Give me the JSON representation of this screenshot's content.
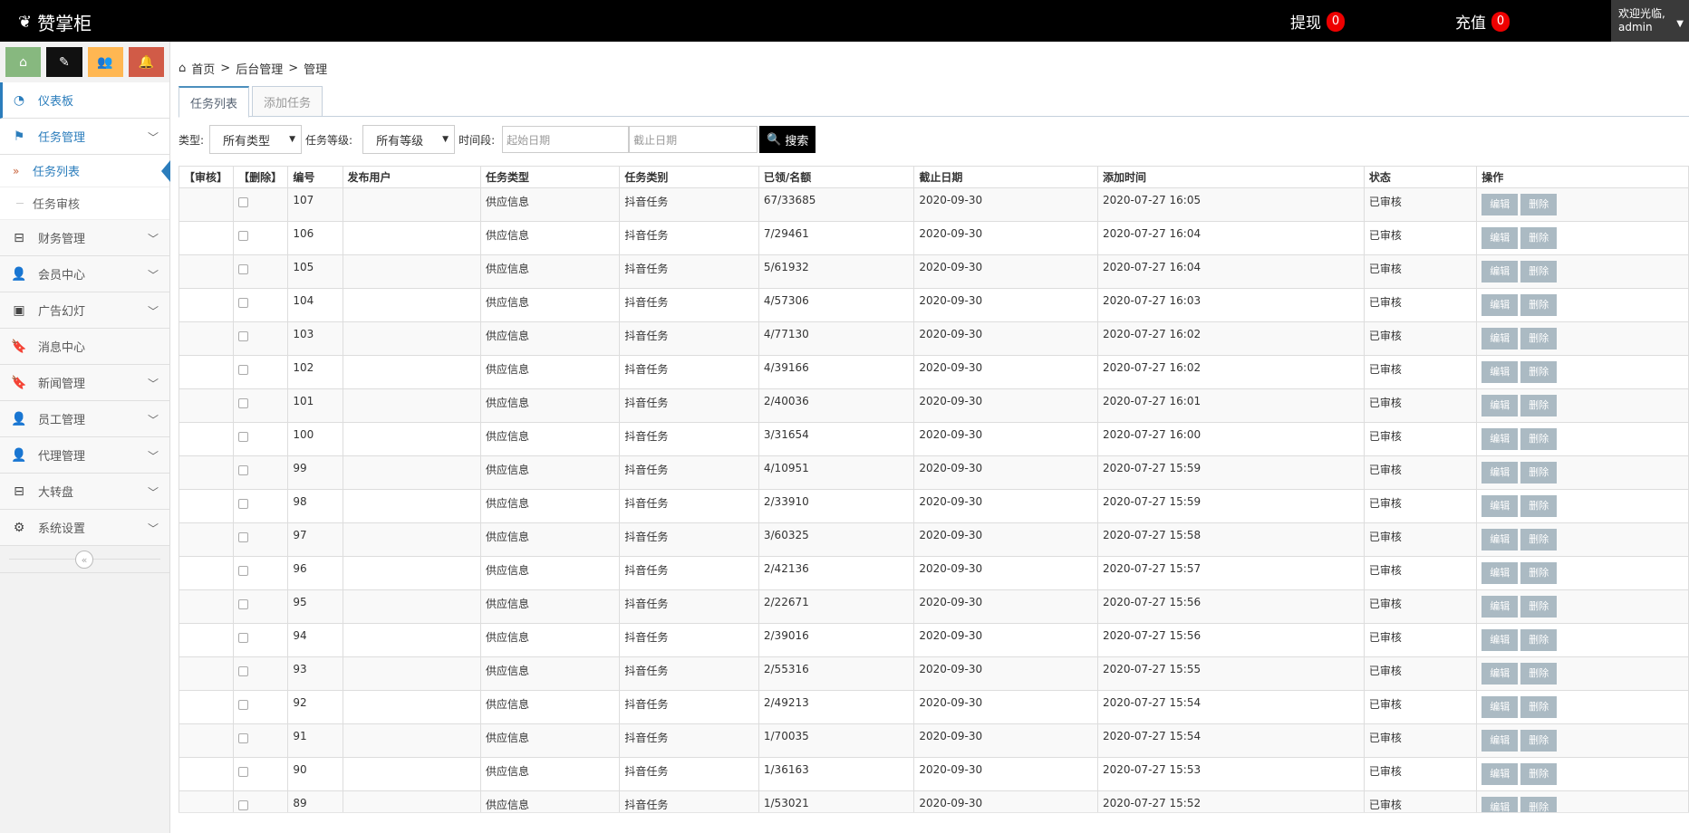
{
  "app": {
    "brand": "赞掌柜",
    "withdraw_label": "提现",
    "withdraw_count": "0",
    "recharge_label": "充值",
    "recharge_count": "0",
    "welcome": "欢迎光临,",
    "username": "admin"
  },
  "colors": {
    "accent": "#2b7dbc",
    "nav": "#000000",
    "badge": "#ee0000",
    "action_btn": "#abbac3"
  },
  "sidebar": {
    "shortcuts": [
      {
        "icon": "home-icon",
        "glyph": "⌂"
      },
      {
        "icon": "pencil-icon",
        "glyph": "✎"
      },
      {
        "icon": "users-icon",
        "glyph": "👥"
      },
      {
        "icon": "bell-icon",
        "glyph": "🔔"
      }
    ],
    "dashboard": "仪表板",
    "task_mgmt": "任务管理",
    "task_list": "任务列表",
    "task_review": "任务审核",
    "finance": "财务管理",
    "members": "会员中心",
    "ads": "广告幻灯",
    "messages": "消息中心",
    "news": "新闻管理",
    "staff": "员工管理",
    "agents": "代理管理",
    "wheel": "大转盘",
    "settings": "系统设置"
  },
  "breadcrumb": {
    "home": "首页",
    "sep": ">",
    "level2": "后台管理",
    "level3": "管理"
  },
  "tabs": {
    "list": "任务列表",
    "add": "添加任务"
  },
  "filters": {
    "type_label": "类型:",
    "type_value": "所有类型",
    "level_label": "任务等级:",
    "level_value": "所有等级",
    "period_label": "时间段:",
    "start_placeholder": "起始日期",
    "end_placeholder": "截止日期",
    "search_label": "搜索"
  },
  "table": {
    "headers": [
      "【审核】",
      "【删除】",
      "编号",
      "发布用户",
      "任务类型",
      "任务类别",
      "已领/名额",
      "截止日期",
      "添加时间",
      "状态",
      "操作"
    ],
    "edit_label": "编辑",
    "delete_label": "删除",
    "rows": [
      {
        "id": "107",
        "user": "",
        "type": "供应信息",
        "category": "抖音任务",
        "quota": "67/33685",
        "deadline": "2020-09-30",
        "added": "2020-07-27 16:05",
        "status": "已审核"
      },
      {
        "id": "106",
        "user": "",
        "type": "供应信息",
        "category": "抖音任务",
        "quota": "7/29461",
        "deadline": "2020-09-30",
        "added": "2020-07-27 16:04",
        "status": "已审核"
      },
      {
        "id": "105",
        "user": "",
        "type": "供应信息",
        "category": "抖音任务",
        "quota": "5/61932",
        "deadline": "2020-09-30",
        "added": "2020-07-27 16:04",
        "status": "已审核"
      },
      {
        "id": "104",
        "user": "",
        "type": "供应信息",
        "category": "抖音任务",
        "quota": "4/57306",
        "deadline": "2020-09-30",
        "added": "2020-07-27 16:03",
        "status": "已审核"
      },
      {
        "id": "103",
        "user": "",
        "type": "供应信息",
        "category": "抖音任务",
        "quota": "4/77130",
        "deadline": "2020-09-30",
        "added": "2020-07-27 16:02",
        "status": "已审核"
      },
      {
        "id": "102",
        "user": "",
        "type": "供应信息",
        "category": "抖音任务",
        "quota": "4/39166",
        "deadline": "2020-09-30",
        "added": "2020-07-27 16:02",
        "status": "已审核"
      },
      {
        "id": "101",
        "user": "",
        "type": "供应信息",
        "category": "抖音任务",
        "quota": "2/40036",
        "deadline": "2020-09-30",
        "added": "2020-07-27 16:01",
        "status": "已审核"
      },
      {
        "id": "100",
        "user": "",
        "type": "供应信息",
        "category": "抖音任务",
        "quota": "3/31654",
        "deadline": "2020-09-30",
        "added": "2020-07-27 16:00",
        "status": "已审核"
      },
      {
        "id": "99",
        "user": "",
        "type": "供应信息",
        "category": "抖音任务",
        "quota": "4/10951",
        "deadline": "2020-09-30",
        "added": "2020-07-27 15:59",
        "status": "已审核"
      },
      {
        "id": "98",
        "user": "",
        "type": "供应信息",
        "category": "抖音任务",
        "quota": "2/33910",
        "deadline": "2020-09-30",
        "added": "2020-07-27 15:59",
        "status": "已审核"
      },
      {
        "id": "97",
        "user": "",
        "type": "供应信息",
        "category": "抖音任务",
        "quota": "3/60325",
        "deadline": "2020-09-30",
        "added": "2020-07-27 15:58",
        "status": "已审核"
      },
      {
        "id": "96",
        "user": "",
        "type": "供应信息",
        "category": "抖音任务",
        "quota": "2/42136",
        "deadline": "2020-09-30",
        "added": "2020-07-27 15:57",
        "status": "已审核"
      },
      {
        "id": "95",
        "user": "",
        "type": "供应信息",
        "category": "抖音任务",
        "quota": "2/22671",
        "deadline": "2020-09-30",
        "added": "2020-07-27 15:56",
        "status": "已审核"
      },
      {
        "id": "94",
        "user": "",
        "type": "供应信息",
        "category": "抖音任务",
        "quota": "2/39016",
        "deadline": "2020-09-30",
        "added": "2020-07-27 15:56",
        "status": "已审核"
      },
      {
        "id": "93",
        "user": "",
        "type": "供应信息",
        "category": "抖音任务",
        "quota": "2/55316",
        "deadline": "2020-09-30",
        "added": "2020-07-27 15:55",
        "status": "已审核"
      },
      {
        "id": "92",
        "user": "",
        "type": "供应信息",
        "category": "抖音任务",
        "quota": "2/49213",
        "deadline": "2020-09-30",
        "added": "2020-07-27 15:54",
        "status": "已审核"
      },
      {
        "id": "91",
        "user": "",
        "type": "供应信息",
        "category": "抖音任务",
        "quota": "1/70035",
        "deadline": "2020-09-30",
        "added": "2020-07-27 15:54",
        "status": "已审核"
      },
      {
        "id": "90",
        "user": "",
        "type": "供应信息",
        "category": "抖音任务",
        "quota": "1/36163",
        "deadline": "2020-09-30",
        "added": "2020-07-27 15:53",
        "status": "已审核"
      },
      {
        "id": "89",
        "user": "",
        "type": "供应信息",
        "category": "抖音任务",
        "quota": "1/53021",
        "deadline": "2020-09-30",
        "added": "2020-07-27 15:52",
        "status": "已审核"
      }
    ]
  }
}
